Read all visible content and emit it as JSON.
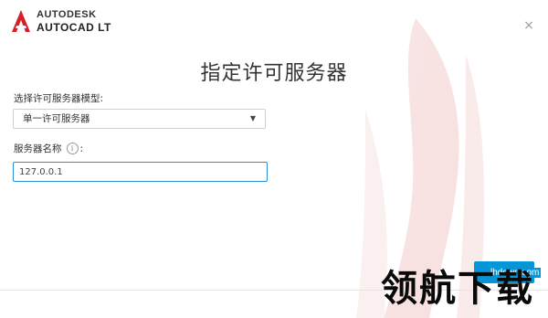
{
  "header": {
    "brand": "AUTODESK",
    "product": "AUTOCAD LT",
    "close_glyph": "×"
  },
  "page_title": "指定许可服务器",
  "form": {
    "server_type_label": "选择许可服务器模型:",
    "server_type_value": "单一许可服务器",
    "server_name_label": "服务器名称",
    "server_name_suffix": ":",
    "server_name_value": "127.0.0.1"
  },
  "footer": {
    "next_button_label": ""
  },
  "watermark": {
    "url": "lhdown.com",
    "text": "领航下载"
  },
  "colors": {
    "accent": "#0696d7",
    "input_focus": "#2b8fd6",
    "logo_red": "#d5202a"
  },
  "icons": {
    "logo": "autodesk-a-logo-icon",
    "close": "close-icon",
    "dropdown": "caret-down-icon",
    "info": "info-icon"
  }
}
